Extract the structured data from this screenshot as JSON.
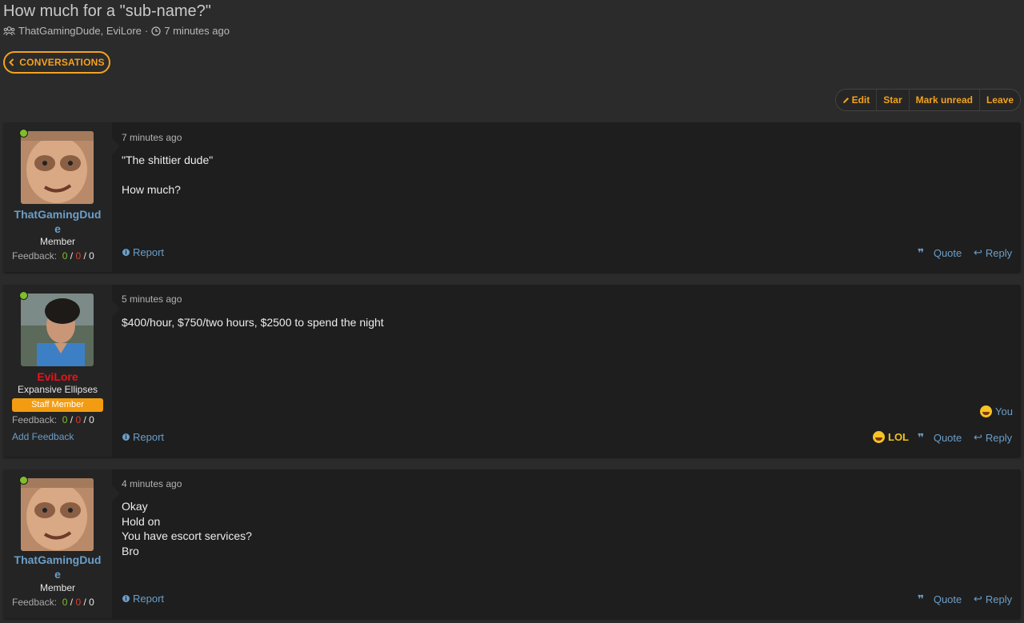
{
  "thread": {
    "title": "How much for a \"sub-name?\"",
    "participants": "ThatGamingDude, EviLore",
    "meta_sep": "·",
    "time": "7 minutes ago",
    "back_label": "CONVERSATIONS"
  },
  "actions": {
    "edit": "Edit",
    "star": "Star",
    "mark_unread": "Mark unread",
    "leave": "Leave"
  },
  "messages": [
    {
      "user": {
        "name": "ThatGamingDud",
        "name_wrap": "e",
        "title": "Member",
        "feedback_label": "Feedback:",
        "fb_pos": "0",
        "fb_neg": "0",
        "fb_neu": "0",
        "sep": "/"
      },
      "time": "7 minutes ago",
      "lines": [
        "\"The shittier dude\"",
        "",
        "How much?"
      ],
      "report": "Report",
      "quote": "Quote",
      "reply": "Reply"
    },
    {
      "user": {
        "name": "EviLore",
        "title": "Expansive Ellipses",
        "badge": "Staff Member",
        "feedback_label": "Feedback:",
        "fb_pos": "0",
        "fb_neg": "0",
        "fb_neu": "0",
        "sep": "/",
        "add_feedback": "Add Feedback"
      },
      "time": "5 minutes ago",
      "lines": [
        "$400/hour, $750/two hours, $2500 to spend the night"
      ],
      "reactions_by": "You",
      "report": "Report",
      "lol": "LOL",
      "quote": "Quote",
      "reply": "Reply"
    },
    {
      "user": {
        "name": "ThatGamingDud",
        "name_wrap": "e",
        "title": "Member",
        "feedback_label": "Feedback:",
        "fb_pos": "0",
        "fb_neg": "0",
        "fb_neu": "0",
        "sep": "/"
      },
      "time": "4 minutes ago",
      "lines": [
        "Okay",
        "Hold on",
        "You have escort services?",
        "Bro"
      ],
      "report": "Report",
      "quote": "Quote",
      "reply": "Reply"
    }
  ],
  "colors": {
    "accent": "#f3a21e",
    "link": "#6b9ec9",
    "staff": "#f39c12",
    "online": "#7fbf2a",
    "admin_name": "#e8141c"
  },
  "icons": [
    "users-icon",
    "clock-icon",
    "chevron-left-icon",
    "pencil-icon",
    "info-icon",
    "quote-icon",
    "reply-icon",
    "laugh-emoji-icon"
  ]
}
